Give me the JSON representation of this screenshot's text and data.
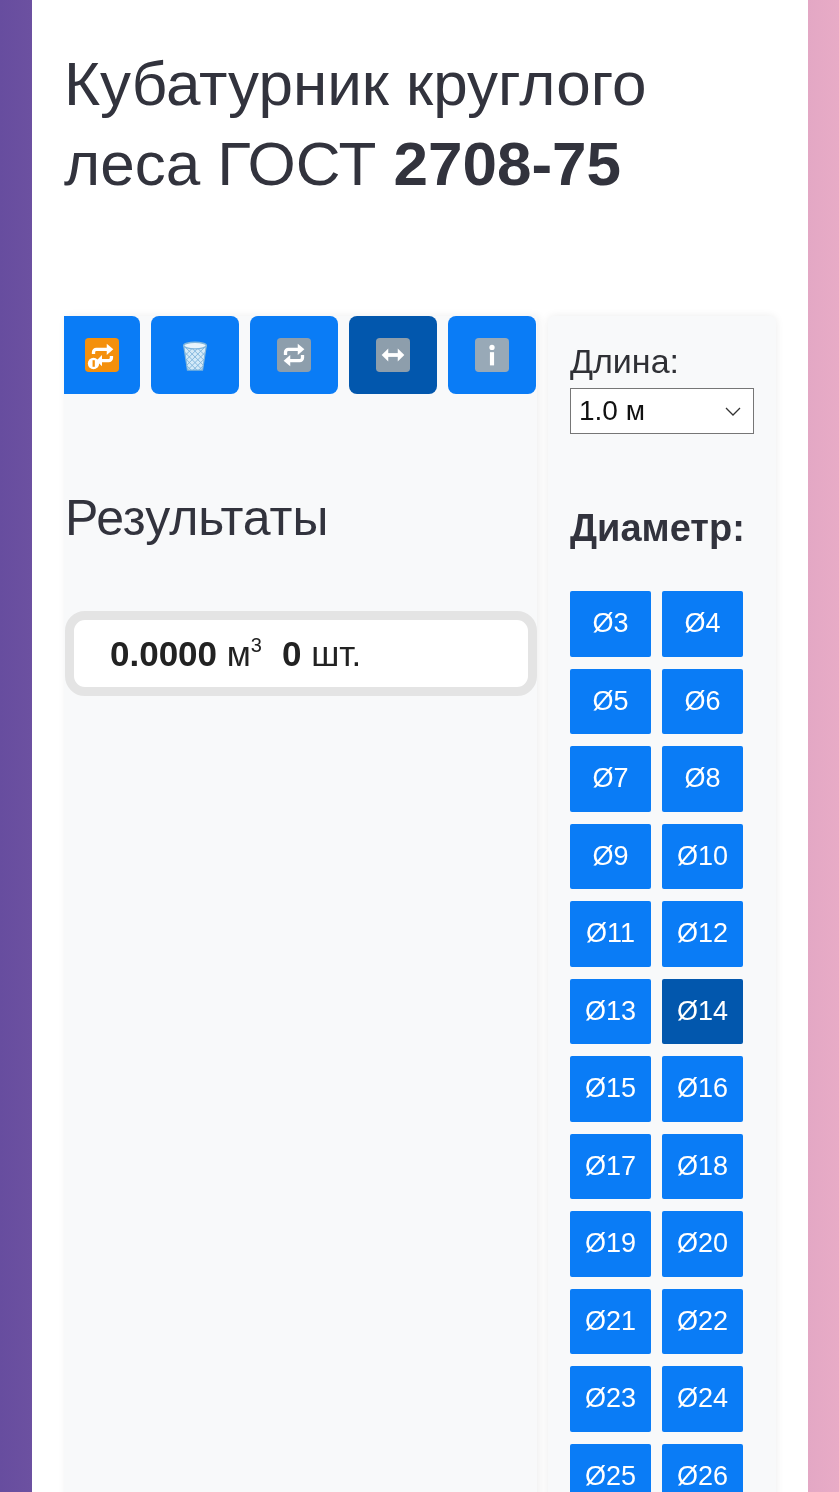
{
  "title": "Кубатурник круглого леса ГОСТ **2708-75**",
  "toolbar": {
    "buttons": [
      {
        "kind": "repeat",
        "selected": false
      },
      {
        "kind": "trash",
        "selected": false
      },
      {
        "kind": "cycle",
        "selected": false
      },
      {
        "kind": "arrows",
        "selected": true
      },
      {
        "kind": "info",
        "selected": false
      }
    ]
  },
  "results": {
    "heading": "Результаты",
    "volume": "**0.0000** м$^{3}$",
    "count": "**0** шт."
  },
  "length": {
    "label": "Длина:",
    "value": "1.0 м"
  },
  "diameter": {
    "label": "Диаметр:",
    "buttons": [
      {
        "label": "Ø3",
        "selected": false
      },
      {
        "label": "Ø4",
        "selected": false
      },
      {
        "label": "Ø5",
        "selected": false
      },
      {
        "label": "Ø6",
        "selected": false
      },
      {
        "label": "Ø7",
        "selected": false
      },
      {
        "label": "Ø8",
        "selected": false
      },
      {
        "label": "Ø9",
        "selected": false
      },
      {
        "label": "Ø10",
        "selected": false
      },
      {
        "label": "Ø11",
        "selected": false
      },
      {
        "label": "Ø12",
        "selected": false
      },
      {
        "label": "Ø13",
        "selected": false
      },
      {
        "label": "Ø14",
        "selected": true
      },
      {
        "label": "Ø15",
        "selected": false
      },
      {
        "label": "Ø16",
        "selected": false
      },
      {
        "label": "Ø17",
        "selected": false
      },
      {
        "label": "Ø18",
        "selected": false
      },
      {
        "label": "Ø19",
        "selected": false
      },
      {
        "label": "Ø20",
        "selected": false
      },
      {
        "label": "Ø21",
        "selected": false
      },
      {
        "label": "Ø22",
        "selected": false
      },
      {
        "label": "Ø23",
        "selected": false
      },
      {
        "label": "Ø24",
        "selected": false
      },
      {
        "label": "Ø25",
        "selected": false
      },
      {
        "label": "Ø26",
        "selected": false
      }
    ]
  }
}
